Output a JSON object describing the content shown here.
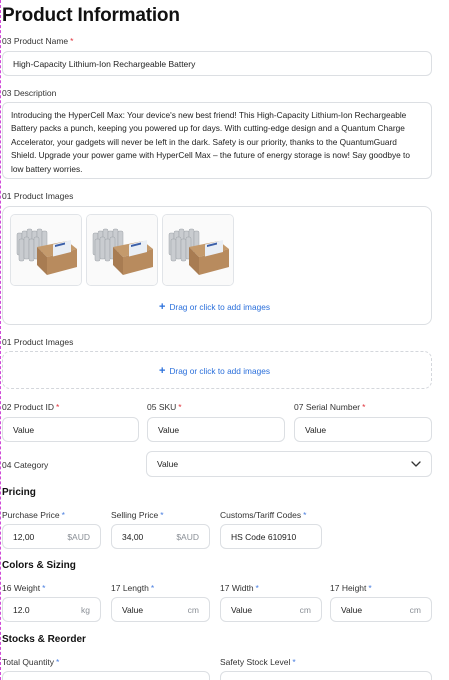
{
  "page": {
    "title": "Product Information"
  },
  "product_name": {
    "label": "03 Product Name",
    "value": "High-Capacity Lithium-Ion Rechargeable Battery"
  },
  "description": {
    "label": "03 Description",
    "value": "Introducing the HyperCell Max: Your device's new best friend! This High-Capacity Lithium-Ion Rechargeable Battery packs a punch, keeping you powered up for days. With cutting-edge design and a Quantum Charge Accelerator, your gadgets will never be left in the dark. Safety is our priority, thanks to the QuantumGuard Shield. Upgrade your power game with HyperCell Max – the future of energy storage is now! Say goodbye to low battery worries."
  },
  "product_images_1": {
    "label": "01 Product Images",
    "add_label": "Drag or click to add images",
    "thumbnails": [
      "battery-pack-image",
      "battery-pack-image",
      "battery-pack-image"
    ]
  },
  "product_images_2": {
    "label": "01 Product Images",
    "add_label": "Drag or click to add images"
  },
  "ids": {
    "product_id": {
      "label": "02 Product ID",
      "value": "Value"
    },
    "sku": {
      "label": "05 SKU",
      "value": "Value"
    },
    "serial": {
      "label": "07 Serial Number",
      "value": "Value"
    }
  },
  "category": {
    "label": "04 Category",
    "value": "Value"
  },
  "pricing": {
    "heading": "Pricing",
    "purchase": {
      "label": "Purchase Price",
      "value": "12,00",
      "unit": "$AUD"
    },
    "selling": {
      "label": "Selling Price",
      "value": "34,00",
      "unit": "$AUD"
    },
    "customs": {
      "label": "Customs/Tariff Codes",
      "value": "HS Code 610910"
    }
  },
  "sizing": {
    "heading": "Colors & Sizing",
    "weight": {
      "label": "16 Weight",
      "value": "12.0",
      "unit": "kg"
    },
    "length": {
      "label": "17 Length",
      "value": "Value",
      "unit": "cm"
    },
    "width": {
      "label": "17 Width",
      "value": "Value",
      "unit": "cm"
    },
    "height": {
      "label": "17 Height",
      "value": "Value",
      "unit": "cm"
    }
  },
  "stock": {
    "heading": "Stocks & Reorder",
    "total_qty": {
      "label": "Total Quantity"
    },
    "safety": {
      "label": "Safety Stock Level"
    }
  },
  "colors": {
    "required_red": "#e0343d",
    "required_blue": "#4a7fe0",
    "link_blue": "#2a6fdb",
    "guide_magenta": "#d04ad8"
  }
}
